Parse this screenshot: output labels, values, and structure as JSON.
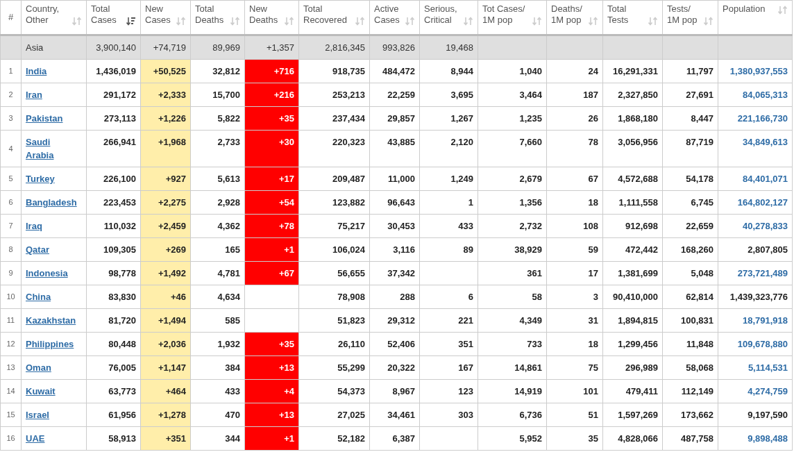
{
  "columns": [
    {
      "label": "#",
      "sortable": false
    },
    {
      "label": "Country, Other",
      "sortable": true,
      "sorted": false
    },
    {
      "label": "Total Cases",
      "sortable": true,
      "sorted": true
    },
    {
      "label": "New Cases",
      "sortable": true,
      "sorted": false
    },
    {
      "label": "Total Deaths",
      "sortable": true,
      "sorted": false
    },
    {
      "label": "New Deaths",
      "sortable": true,
      "sorted": false
    },
    {
      "label": "Total Recovered",
      "sortable": true,
      "sorted": false
    },
    {
      "label": "Active Cases",
      "sortable": true,
      "sorted": false
    },
    {
      "label": "Serious, Critical",
      "sortable": true,
      "sorted": false
    },
    {
      "label": "Tot Cases/ 1M pop",
      "sortable": true,
      "sorted": false
    },
    {
      "label": "Deaths/ 1M pop",
      "sortable": true,
      "sorted": false
    },
    {
      "label": "Total Tests",
      "sortable": true,
      "sorted": false
    },
    {
      "label": "Tests/ 1M pop",
      "sortable": true,
      "sorted": false
    },
    {
      "label": "Population",
      "sortable": true,
      "sorted": false
    }
  ],
  "continent_row": {
    "country": "Asia",
    "total_cases": "3,900,140",
    "new_cases": "+74,719",
    "total_deaths": "89,969",
    "new_deaths": "+1,357",
    "total_recovered": "2,816,345",
    "active_cases": "993,826",
    "serious": "19,468"
  },
  "rows": [
    {
      "rank": "1",
      "country": "India",
      "total_cases": "1,436,019",
      "new_cases": "+50,525",
      "total_deaths": "32,812",
      "new_deaths": "+716",
      "total_recovered": "918,735",
      "active_cases": "484,472",
      "serious": "8,944",
      "cases_per_1m": "1,040",
      "deaths_per_1m": "24",
      "total_tests": "16,291,331",
      "tests_per_1m": "11,797",
      "population": "1,380,937,553",
      "population_link": true
    },
    {
      "rank": "2",
      "country": "Iran",
      "total_cases": "291,172",
      "new_cases": "+2,333",
      "total_deaths": "15,700",
      "new_deaths": "+216",
      "total_recovered": "253,213",
      "active_cases": "22,259",
      "serious": "3,695",
      "cases_per_1m": "3,464",
      "deaths_per_1m": "187",
      "total_tests": "2,327,850",
      "tests_per_1m": "27,691",
      "population": "84,065,313",
      "population_link": true
    },
    {
      "rank": "3",
      "country": "Pakistan",
      "total_cases": "273,113",
      "new_cases": "+1,226",
      "total_deaths": "5,822",
      "new_deaths": "+35",
      "total_recovered": "237,434",
      "active_cases": "29,857",
      "serious": "1,267",
      "cases_per_1m": "1,235",
      "deaths_per_1m": "26",
      "total_tests": "1,868,180",
      "tests_per_1m": "8,447",
      "population": "221,166,730",
      "population_link": true
    },
    {
      "rank": "4",
      "country": "Saudi Arabia",
      "total_cases": "266,941",
      "new_cases": "+1,968",
      "total_deaths": "2,733",
      "new_deaths": "+30",
      "total_recovered": "220,323",
      "active_cases": "43,885",
      "serious": "2,120",
      "cases_per_1m": "7,660",
      "deaths_per_1m": "78",
      "total_tests": "3,056,956",
      "tests_per_1m": "87,719",
      "population": "34,849,613",
      "population_link": true
    },
    {
      "rank": "5",
      "country": "Turkey",
      "total_cases": "226,100",
      "new_cases": "+927",
      "total_deaths": "5,613",
      "new_deaths": "+17",
      "total_recovered": "209,487",
      "active_cases": "11,000",
      "serious": "1,249",
      "cases_per_1m": "2,679",
      "deaths_per_1m": "67",
      "total_tests": "4,572,688",
      "tests_per_1m": "54,178",
      "population": "84,401,071",
      "population_link": true
    },
    {
      "rank": "6",
      "country": "Bangladesh",
      "total_cases": "223,453",
      "new_cases": "+2,275",
      "total_deaths": "2,928",
      "new_deaths": "+54",
      "total_recovered": "123,882",
      "active_cases": "96,643",
      "serious": "1",
      "cases_per_1m": "1,356",
      "deaths_per_1m": "18",
      "total_tests": "1,111,558",
      "tests_per_1m": "6,745",
      "population": "164,802,127",
      "population_link": true
    },
    {
      "rank": "7",
      "country": "Iraq",
      "total_cases": "110,032",
      "new_cases": "+2,459",
      "total_deaths": "4,362",
      "new_deaths": "+78",
      "total_recovered": "75,217",
      "active_cases": "30,453",
      "serious": "433",
      "cases_per_1m": "2,732",
      "deaths_per_1m": "108",
      "total_tests": "912,698",
      "tests_per_1m": "22,659",
      "population": "40,278,833",
      "population_link": true
    },
    {
      "rank": "8",
      "country": "Qatar",
      "total_cases": "109,305",
      "new_cases": "+269",
      "total_deaths": "165",
      "new_deaths": "+1",
      "total_recovered": "106,024",
      "active_cases": "3,116",
      "serious": "89",
      "cases_per_1m": "38,929",
      "deaths_per_1m": "59",
      "total_tests": "472,442",
      "tests_per_1m": "168,260",
      "population": "2,807,805",
      "population_link": false
    },
    {
      "rank": "9",
      "country": "Indonesia",
      "total_cases": "98,778",
      "new_cases": "+1,492",
      "total_deaths": "4,781",
      "new_deaths": "+67",
      "total_recovered": "56,655",
      "active_cases": "37,342",
      "cases_per_1m": "361",
      "deaths_per_1m": "17",
      "total_tests": "1,381,699",
      "tests_per_1m": "5,048",
      "population": "273,721,489",
      "population_link": true
    },
    {
      "rank": "10",
      "country": "China",
      "total_cases": "83,830",
      "new_cases": "+46",
      "total_deaths": "4,634",
      "total_recovered": "78,908",
      "active_cases": "288",
      "serious": "6",
      "cases_per_1m": "58",
      "deaths_per_1m": "3",
      "total_tests": "90,410,000",
      "tests_per_1m": "62,814",
      "population": "1,439,323,776",
      "population_link": false
    },
    {
      "rank": "11",
      "country": "Kazakhstan",
      "total_cases": "81,720",
      "new_cases": "+1,494",
      "total_deaths": "585",
      "total_recovered": "51,823",
      "active_cases": "29,312",
      "serious": "221",
      "cases_per_1m": "4,349",
      "deaths_per_1m": "31",
      "total_tests": "1,894,815",
      "tests_per_1m": "100,831",
      "population": "18,791,918",
      "population_link": true
    },
    {
      "rank": "12",
      "country": "Philippines",
      "total_cases": "80,448",
      "new_cases": "+2,036",
      "total_deaths": "1,932",
      "new_deaths": "+35",
      "total_recovered": "26,110",
      "active_cases": "52,406",
      "serious": "351",
      "cases_per_1m": "733",
      "deaths_per_1m": "18",
      "total_tests": "1,299,456",
      "tests_per_1m": "11,848",
      "population": "109,678,880",
      "population_link": true
    },
    {
      "rank": "13",
      "country": "Oman",
      "total_cases": "76,005",
      "new_cases": "+1,147",
      "total_deaths": "384",
      "new_deaths": "+13",
      "total_recovered": "55,299",
      "active_cases": "20,322",
      "serious": "167",
      "cases_per_1m": "14,861",
      "deaths_per_1m": "75",
      "total_tests": "296,989",
      "tests_per_1m": "58,068",
      "population": "5,114,531",
      "population_link": true
    },
    {
      "rank": "14",
      "country": "Kuwait",
      "total_cases": "63,773",
      "new_cases": "+464",
      "total_deaths": "433",
      "new_deaths": "+4",
      "total_recovered": "54,373",
      "active_cases": "8,967",
      "serious": "123",
      "cases_per_1m": "14,919",
      "deaths_per_1m": "101",
      "total_tests": "479,411",
      "tests_per_1m": "112,149",
      "population": "4,274,759",
      "population_link": true
    },
    {
      "rank": "15",
      "country": "Israel",
      "total_cases": "61,956",
      "new_cases": "+1,278",
      "total_deaths": "470",
      "new_deaths": "+13",
      "total_recovered": "27,025",
      "active_cases": "34,461",
      "serious": "303",
      "cases_per_1m": "6,736",
      "deaths_per_1m": "51",
      "total_tests": "1,597,269",
      "tests_per_1m": "173,662",
      "population": "9,197,590",
      "population_link": false
    },
    {
      "rank": "16",
      "country": "UAE",
      "total_cases": "58,913",
      "new_cases": "+351",
      "total_deaths": "344",
      "new_deaths": "+1",
      "total_recovered": "52,182",
      "active_cases": "6,387",
      "cases_per_1m": "5,952",
      "deaths_per_1m": "35",
      "total_tests": "4,828,066",
      "tests_per_1m": "487,758",
      "population": "9,898,488",
      "population_link": true
    }
  ]
}
